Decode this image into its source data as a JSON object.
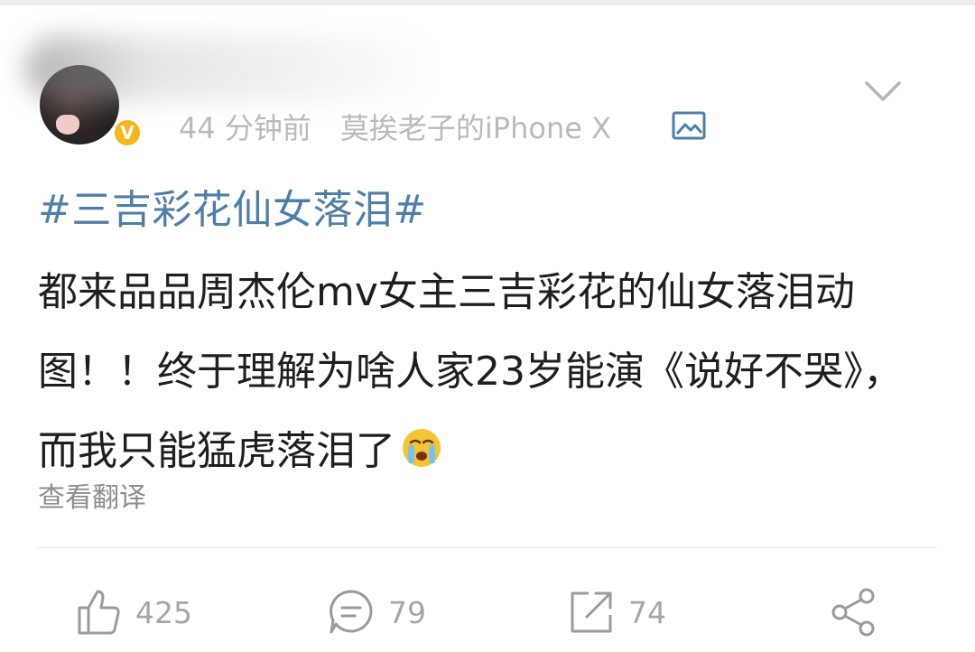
{
  "header": {
    "time_ago": "44 分钟前",
    "device": "莫挨老子的iPhone X",
    "vip_badge": "V"
  },
  "post": {
    "topic": "#三吉彩花仙女落泪#",
    "text": "都来品品周杰伦mv女主三吉彩花的仙女落泪动图！！终于理解为啥人家23岁能演《说好不哭》，而我只能猛虎落泪了",
    "translate_label": "查看翻译"
  },
  "actions": {
    "likes": "425",
    "comments": "79",
    "reposts": "74"
  },
  "colors": {
    "topic": "#4f7ea6",
    "badge": "#f5b51b",
    "meta": "#b9b9b9",
    "icon": "#9a9a9a"
  }
}
